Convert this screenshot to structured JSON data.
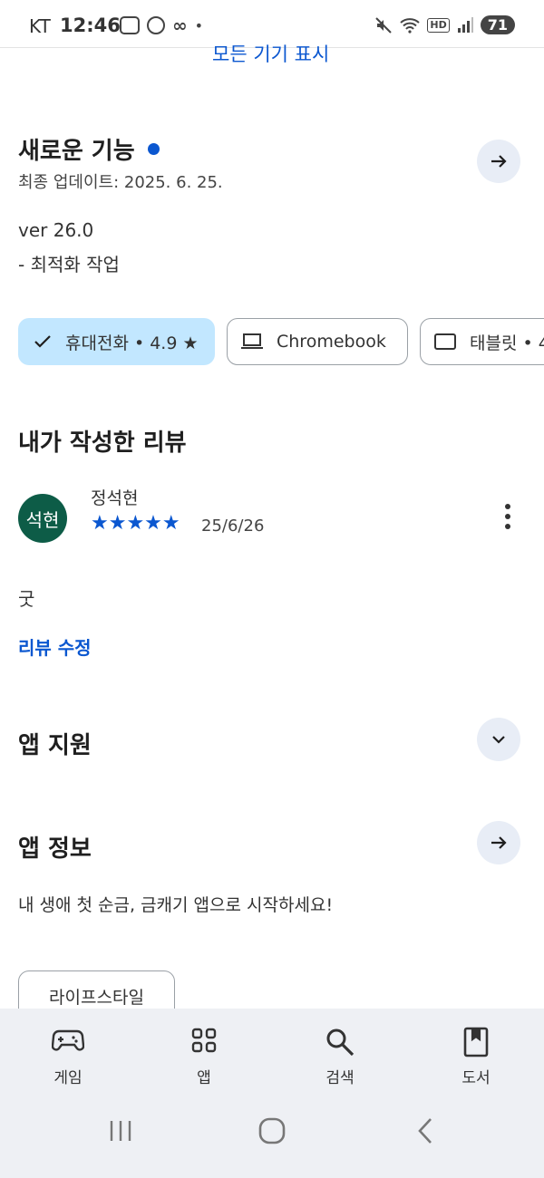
{
  "status_bar": {
    "carrier": "KT",
    "time": "12:46",
    "battery": "71"
  },
  "top_link": "모든 기기 표시",
  "whats_new": {
    "title": "새로운 기능",
    "updated": "최종 업데이트: 2025. 6. 25.",
    "version": "ver 26.0",
    "note": "- 최적화 작업"
  },
  "device_chips": [
    {
      "label": "휴대전화 • 4.9 ★",
      "selected": true
    },
    {
      "label": "Chromebook",
      "selected": false
    },
    {
      "label": "태블릿 • 4",
      "selected": false
    }
  ],
  "my_review": {
    "title": "내가 작성한 리뷰",
    "avatar_text": "석현",
    "author": "정석현",
    "stars": "★★★★★",
    "rating": 5,
    "date": "25/6/26",
    "text": "굿",
    "edit_link": "리뷰 수정"
  },
  "app_support": {
    "title": "앱 지원"
  },
  "app_info": {
    "title": "앱 정보",
    "description": "내 생애 첫 순금, 금캐기 앱으로 시작하세요!",
    "tag": "라이프스타일"
  },
  "bottom_nav": [
    {
      "label": "게임",
      "icon": "gamepad-icon"
    },
    {
      "label": "앱",
      "icon": "apps-grid-icon"
    },
    {
      "label": "검색",
      "icon": "search-icon"
    },
    {
      "label": "도서",
      "icon": "book-icon"
    }
  ],
  "colors": {
    "accent": "#0b57d0",
    "chip_selected_bg": "#c2e7ff",
    "avatar_bg": "#0d5c47",
    "nav_bg": "#eef0f4"
  }
}
